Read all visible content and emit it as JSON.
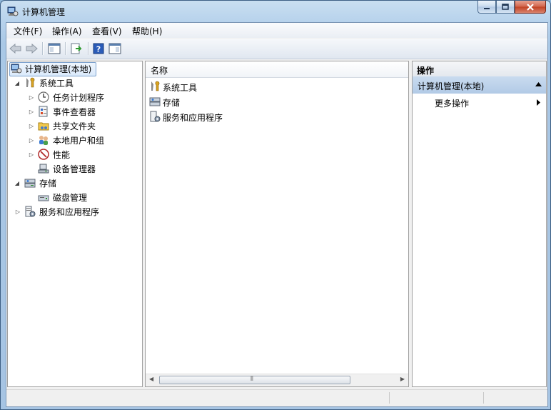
{
  "window": {
    "title": "计算机管理"
  },
  "menubar": {
    "items": [
      "文件(F)",
      "操作(A)",
      "查看(V)",
      "帮助(H)"
    ]
  },
  "toolbar": {
    "icons": [
      "back-arrow-icon",
      "forward-arrow-icon",
      "show-hide-console-tree-icon",
      "export-list-icon",
      "help-icon",
      "show-hide-action-pane-icon"
    ]
  },
  "tree": {
    "root": "计算机管理(本地)",
    "system_tools": "系统工具",
    "task_scheduler": "任务计划程序",
    "event_viewer": "事件查看器",
    "shared_folders": "共享文件夹",
    "local_users": "本地用户和组",
    "performance": "性能",
    "device_manager": "设备管理器",
    "storage": "存储",
    "disk_management": "磁盘管理",
    "services_apps": "服务和应用程序"
  },
  "list": {
    "column_name": "名称",
    "items": [
      "系统工具",
      "存储",
      "服务和应用程序"
    ]
  },
  "actions": {
    "header": "操作",
    "group": "计算机管理(本地)",
    "more": "更多操作"
  },
  "colors": {
    "selection": "#dbeafb",
    "titlebar": "#b7d2ec",
    "close": "#c14123"
  }
}
